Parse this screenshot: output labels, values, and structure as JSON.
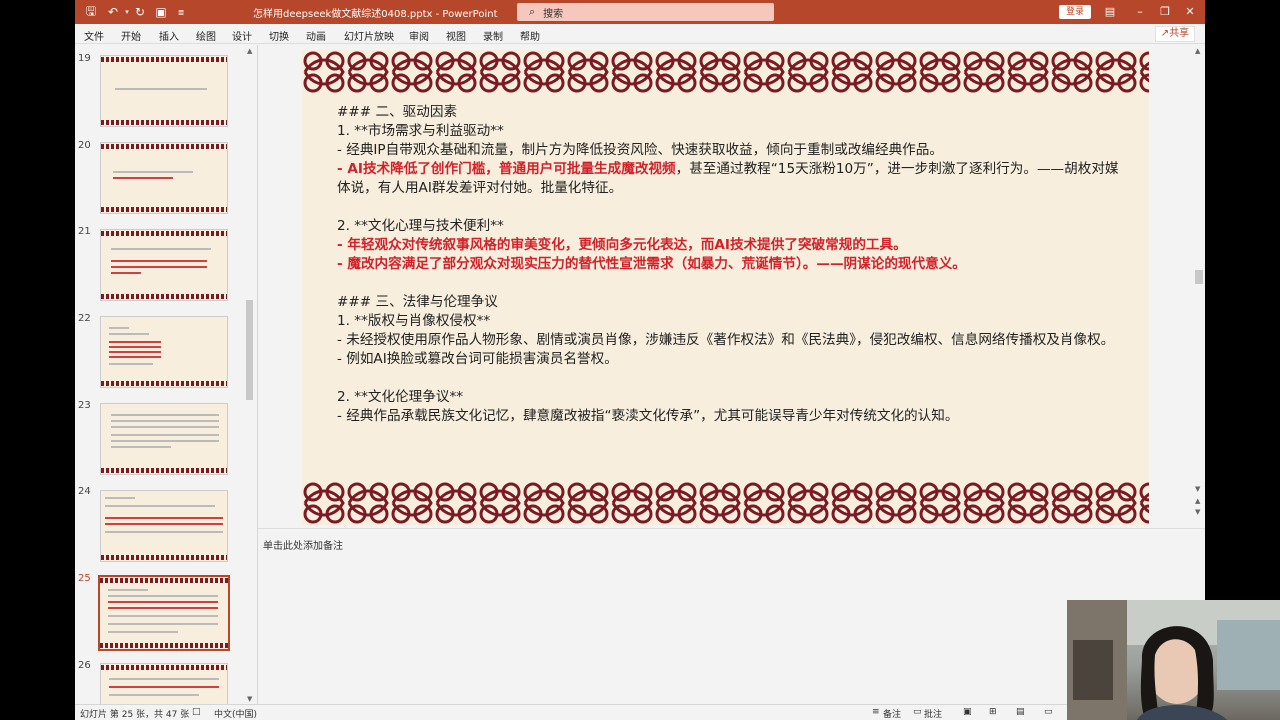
{
  "app": {
    "file_title": "怎样用deepseek做文献综述0408.pptx  -  PowerPoint",
    "search_placeholder": "搜索",
    "login_label": "登录",
    "share_label": "共享",
    "brand_color": "#b7472a"
  },
  "menu": [
    "文件",
    "开始",
    "插入",
    "绘图",
    "设计",
    "切换",
    "动画",
    "幻灯片放映",
    "审阅",
    "视图",
    "录制",
    "帮助"
  ],
  "thumbnails": [
    {
      "num": "19"
    },
    {
      "num": "20"
    },
    {
      "num": "21"
    },
    {
      "num": "22"
    },
    {
      "num": "23"
    },
    {
      "num": "24"
    },
    {
      "num": "25",
      "active": true
    },
    {
      "num": "26"
    }
  ],
  "slide": {
    "lines": [
      {
        "text": "### 二、驱动因素"
      },
      {
        "text": "1. **市场需求与利益驱动**"
      },
      {
        "text": "   - 经典IP自带观众基础和流量，制片方为降低投资风险、快速获取收益，倾向于重制或改编经典作品。"
      },
      {
        "red": "   - AI技术降低了创作门槛，普通用户可批量生成魔改视频",
        "text": "，甚至通过教程“15天涨粉10万”，进一步刺激了逐利行为。——胡枚对媒体说，有人用AI群发差评对付她。批量化特征。"
      },
      {
        "text": ""
      },
      {
        "text": "2. **文化心理与技术便利**"
      },
      {
        "red": "   - 年轻观众对传统叙事风格的审美变化，更倾向多元化表达，而AI技术提供了突破常规的工具。"
      },
      {
        "red": "   - 魔改内容满足了部分观众对现实压力的替代性宣泄需求（如暴力、荒诞情节）。——阴谋论的现代意义。"
      },
      {
        "text": ""
      },
      {
        "text": "### 三、法律与伦理争议"
      },
      {
        "text": "1. **版权与肖像权侵权**"
      },
      {
        "text": "   - 未经授权使用原作品人物形象、剧情或演员肖像，涉嫌违反《著作权法》和《民法典》，侵犯改编权、信息网络传播权及肖像权。"
      },
      {
        "text": "   - 例如AI换脸或篡改台词可能损害演员名誉权。"
      },
      {
        "text": ""
      },
      {
        "text": "2. **文化伦理争议**"
      },
      {
        "text": "   - 经典作品承载民族文化记忆，肆意魔改被指“亵渎文化传承”，尤其可能误导青少年对传统文化的认知。"
      }
    ]
  },
  "notes": {
    "placeholder": "单击此处添加备注"
  },
  "status": {
    "slide_info": "幻灯片 第 25 张，共 47 张",
    "language": "中文(中国)",
    "notes_label": "备注",
    "comments_label": "批注"
  }
}
